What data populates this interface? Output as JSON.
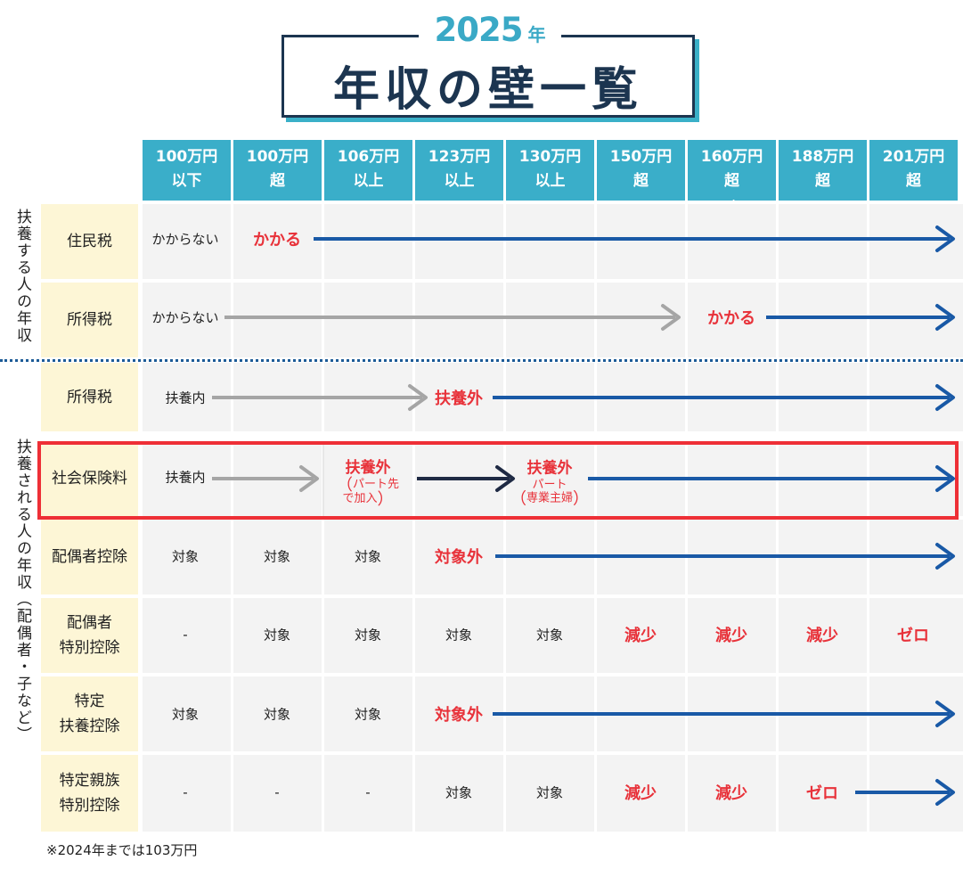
{
  "title": {
    "year_number": "2025",
    "year_unit": "年",
    "main": "年収の壁一覧"
  },
  "columns": [
    {
      "line1": "100万円",
      "line2": "以下"
    },
    {
      "line1": "100万円",
      "line2": "超"
    },
    {
      "line1": "106万円",
      "line2": "以上"
    },
    {
      "line1": "123万円",
      "line2": "以上"
    },
    {
      "line1": "130万円",
      "line2": "以上"
    },
    {
      "line1": "150万円",
      "line2": "超"
    },
    {
      "line1": "160万円",
      "line2": "超",
      "note": "※"
    },
    {
      "line1": "188万円",
      "line2": "超"
    },
    {
      "line1": "201万円",
      "line2": "超"
    }
  ],
  "side_labels": {
    "earner": "扶養する人の年収",
    "dependent": "扶養される人の年収（配偶者・子など）"
  },
  "rows": [
    {
      "label": "住民税"
    },
    {
      "label": "所得税"
    },
    {
      "label": "所得税"
    },
    {
      "label": "社会保険料"
    },
    {
      "label": "配偶者控除"
    },
    {
      "label_line1": "配偶者",
      "label_line2": "特別控除"
    },
    {
      "label_line1": "特定",
      "label_line2": "扶養控除"
    },
    {
      "label_line1": "特定親族",
      "label_line2": "特別控除"
    }
  ],
  "cells": {
    "r0_c0": "かからない",
    "r0_c1": "かかる",
    "r1_c0": "かからない",
    "r1_c6": "かかる",
    "r2_c0": "扶養内",
    "r2_c3": "扶養外",
    "r3_c0": "扶養内",
    "r3_c2_main": "扶養外",
    "r3_c2_sub1": "パート先",
    "r3_c2_sub2": "で加入",
    "r3_c4_main": "扶養外",
    "r3_c4_sub1": "パート",
    "r3_c4_sub2": "専業主婦",
    "r4_c0": "対象",
    "r4_c1": "対象",
    "r4_c2": "対象",
    "r4_c3": "対象外",
    "r5_c0": "-",
    "r5_c1": "対象",
    "r5_c2": "対象",
    "r5_c3": "対象",
    "r5_c4": "対象",
    "r5_c5": "減少",
    "r5_c6": "減少",
    "r5_c7": "減少",
    "r5_c8": "ゼロ",
    "r6_c0": "対象",
    "r6_c1": "対象",
    "r6_c2": "対象",
    "r6_c3": "対象外",
    "r7_c0": "-",
    "r7_c1": "-",
    "r7_c2": "-",
    "r7_c3": "対象",
    "r7_c4": "対象",
    "r7_c5": "減少",
    "r7_c6": "減少",
    "r7_c7": "ゼロ"
  },
  "footnote": "※2024年までは103万円",
  "colors": {
    "header_bg": "#3aaec9",
    "label_bg": "#fdf6d6",
    "cell_bg": "#f3f3f3",
    "accent_red": "#e8323a",
    "arrow_blue": "#1959a6",
    "arrow_gray": "#a5a5a5",
    "arrow_navy": "#1f2a44",
    "title_navy": "#1c3550"
  }
}
